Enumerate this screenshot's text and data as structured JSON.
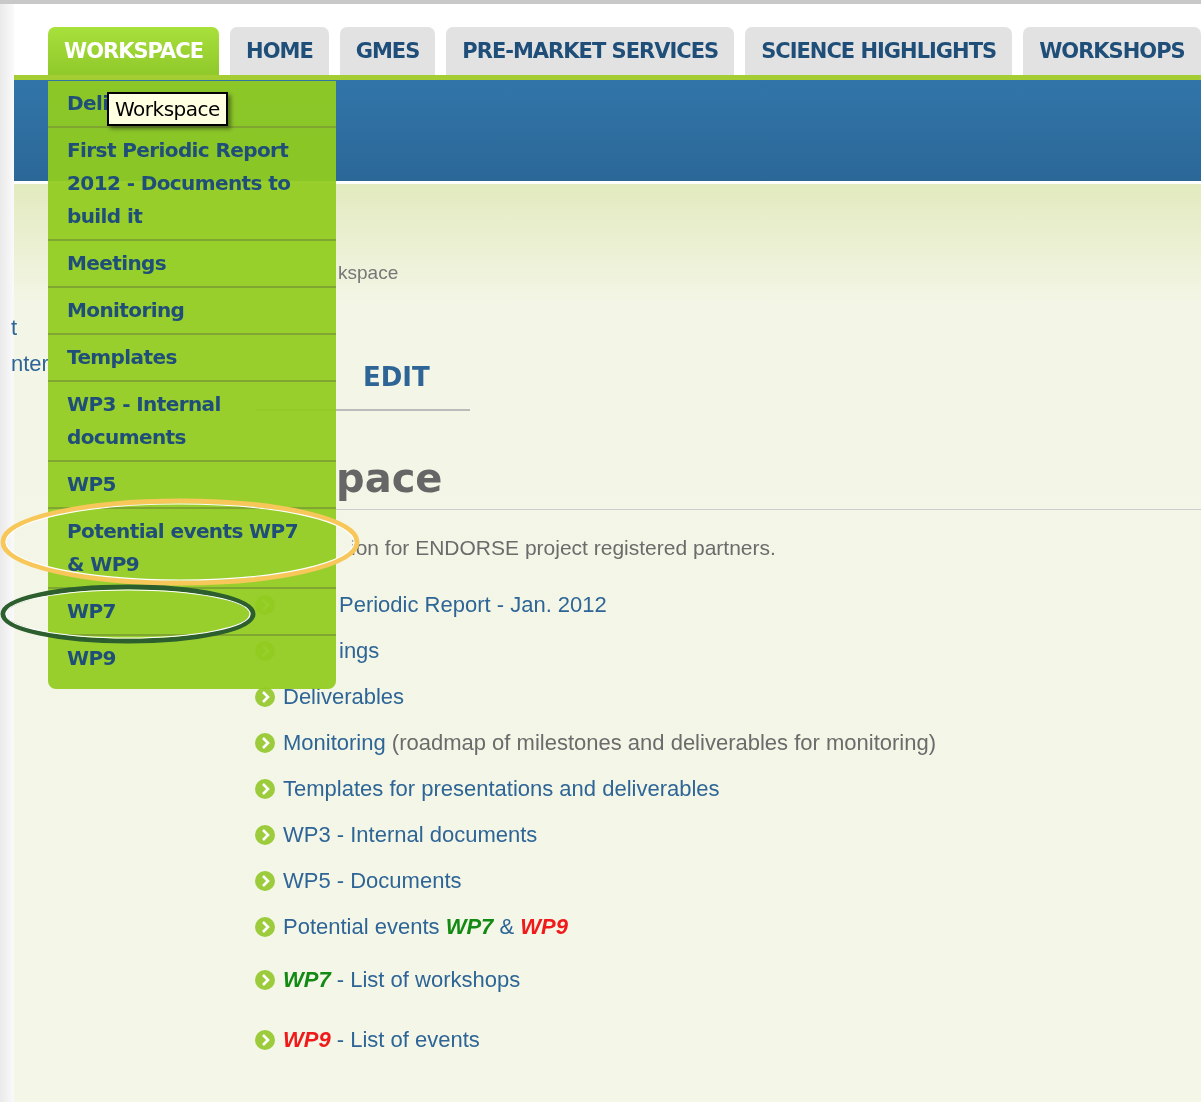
{
  "nav_tabs": [
    {
      "label": "WORKSPACE",
      "selected": true
    },
    {
      "label": "HOME",
      "selected": false
    },
    {
      "label": "GMES",
      "selected": false
    },
    {
      "label": "PRE-MARKET SERVICES",
      "selected": false
    },
    {
      "label": "SCIENCE HIGHLIGHTS",
      "selected": false
    },
    {
      "label": "WORKSHOPS",
      "selected": false
    }
  ],
  "dropdown_menu": {
    "items": [
      "Deli",
      "First Periodic Report 2012 - Documents to build it",
      "Meetings",
      "Monitoring",
      "Templates",
      "WP3 - Internal documents",
      "WP5",
      "Potential events WP7 & WP9",
      "WP7",
      "WP9"
    ],
    "tooltip": "Workspace"
  },
  "annotations": [
    {
      "color": "#f7c75a"
    },
    {
      "color": "#2c5e2e"
    }
  ],
  "sidebar_fragments": [
    "t",
    "nter"
  ],
  "breadcrumb": "kspace",
  "view_tabs": [
    {
      "label": "EDIT",
      "selected": false
    }
  ],
  "heading": "pace",
  "intro": "ion for ENDORSE project registered partners.",
  "links": [
    {
      "parts": [
        {
          "text": "Periodic Report - Jan. 2012",
          "color": "#2e6596"
        }
      ]
    },
    {
      "parts": [
        {
          "text": "ings",
          "color": "#2e6596"
        }
      ]
    },
    {
      "parts": [
        {
          "text": "Deliverables",
          "color": "#2e6596"
        }
      ]
    },
    {
      "parts": [
        {
          "text": "Monitoring",
          "color": "#2e6596"
        },
        {
          "text": " (roadmap of milestones and deliverables for monitoring)",
          "color": "#6b6b6b"
        }
      ]
    },
    {
      "parts": [
        {
          "text": "Templates for presentations and deliverables",
          "color": "#2e6596"
        }
      ]
    },
    {
      "parts": [
        {
          "text": "WP3 - Internal documents",
          "color": "#2e6596"
        }
      ]
    },
    {
      "parts": [
        {
          "text": "WP5 - Documents",
          "color": "#2e6596"
        }
      ]
    },
    {
      "parts": [
        {
          "text": "Potential events ",
          "color": "#2e6596"
        },
        {
          "text": "WP7",
          "color": "#138a13",
          "emphasis": true
        },
        {
          "text": " & ",
          "color": "#2e6596"
        },
        {
          "text": "WP9",
          "color": "#f01a1a",
          "emphasis": true
        }
      ]
    },
    {
      "parts": [
        {
          "text": "WP7",
          "color": "#138a13",
          "emphasis": true
        },
        {
          "text": " - List of workshops",
          "color": "#2e6596"
        }
      ]
    },
    {
      "parts": [
        {
          "text": "WP9",
          "color": "#f01a1a",
          "emphasis": true
        },
        {
          "text": " - List of events",
          "color": "#2e6596"
        }
      ]
    }
  ]
}
